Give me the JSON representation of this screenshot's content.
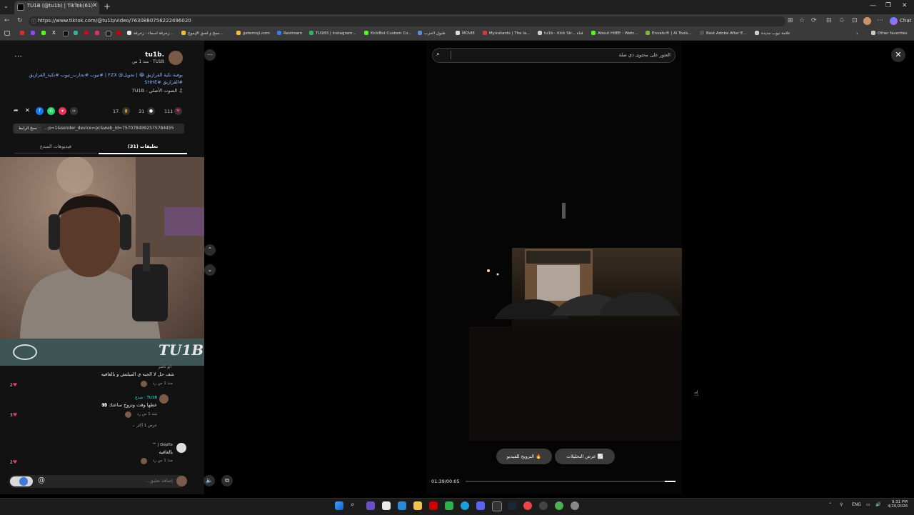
{
  "browser": {
    "tab_title": "TU1B (@tu1b) | TikTok(61)",
    "url": "https://www.tiktok.com/@tu1b/video/7630880756222496020",
    "chat_label": "Chat",
    "bookmarks": [
      {
        "label": "زخرفة اسماء - زخرفة...",
        "color": "#e8e8e8"
      },
      {
        "label": "نسخ و لصق الإيموج...",
        "color": "#f3c13a"
      },
      {
        "label": "getemoji.com",
        "color": "#f3c13a"
      },
      {
        "label": "Restream",
        "color": "#3a7bf0"
      },
      {
        "label": "TU1B3 | Instagram...",
        "color": "#2fb463"
      },
      {
        "label": "KickBot Custom Co...",
        "color": "#53fc18"
      },
      {
        "label": "طبول الحرب",
        "color": "#5b8bd9"
      },
      {
        "label": "MOVIE",
        "color": "#dddddd"
      },
      {
        "label": "Myinstants | The la...",
        "color": "#d23b3b"
      },
      {
        "label": "tu1b - Kick Str... قناة",
        "color": "#cccccc"
      },
      {
        "label": "About HIIEE - Watc...",
        "color": "#53fc18"
      },
      {
        "label": "Envato® | AI Tools...",
        "color": "#82b541"
      },
      {
        "label": "Best Adobe After E...",
        "color": "#333333"
      },
      {
        "label": "علامة تيوب جديدة",
        "color": "#cccccc"
      }
    ],
    "other_favorites": "Other favorites"
  },
  "post": {
    "username": "tu1b.",
    "display_name": "TU1B",
    "time_ago": "منذ 1 س",
    "caption": "بوفية تكية القرازيق 😂 | ⁦@تحويل⁩ FZX | #تيوب #تحارب_تيوب #تكية_القرازيق #القرازيق #SHHE",
    "sound": "الصوت الأصلي - TU1B",
    "likes": "111",
    "comments": "31",
    "saves": "17",
    "link_text": "...p=1&sender_device=pc&web_id=7570784992575784455",
    "copy_link": "نسخ الرابط",
    "tab_comments": "تعليقات (31)",
    "tab_creator_videos": "فيديوهات المبدع"
  },
  "comments": [
    {
      "author": "ابو ناصر",
      "text": "شف حل لا الحبه ي الميلتش و بالعافيه",
      "meta": "منذ 1 س  رد",
      "likes": "2"
    },
    {
      "author": "TU1B · مبدع",
      "text": "عطها وقت وتروح ساعتك 👀",
      "meta": "منذ 1 س  رد",
      "likes": "3"
    },
    {
      "author": "Dopfix | ™",
      "text": "بالعافيه",
      "meta": "منذ 1 س  رد",
      "likes": "2"
    }
  ],
  "more_replies": "عرض 1 أكثر",
  "comment_placeholder": "إضافة تعليق...",
  "at_symbol": "@",
  "webcam_brand": "TU1B",
  "video": {
    "search_placeholder": "العثور على محتوى ذي صلة",
    "promote_label": "الترويج للفيديو",
    "analytics_label": "عرض التحليلات",
    "time": "01:39/00:05",
    "progress": 0.95
  },
  "taskbar": {
    "lang": "ENG",
    "time": "9:31 PM",
    "date": "4/20/2026"
  }
}
